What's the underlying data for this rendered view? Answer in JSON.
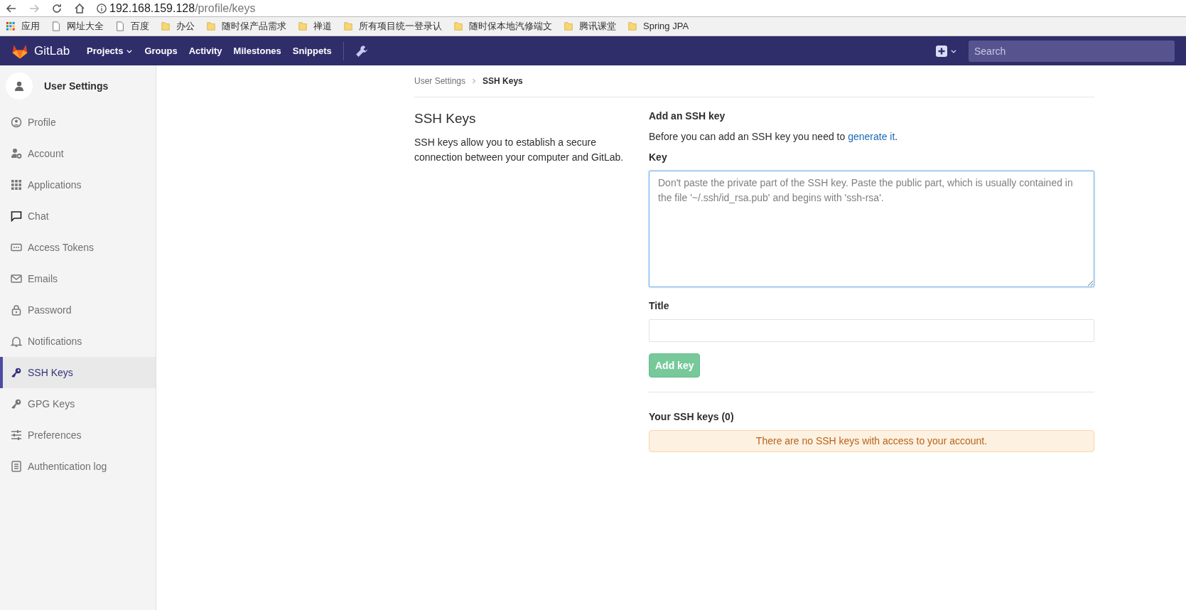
{
  "browser": {
    "url_host": "192.168.159.128",
    "url_path": "/profile/keys",
    "bookmarks": [
      {
        "kind": "apps",
        "label": "应用"
      },
      {
        "kind": "page",
        "label": "网址大全"
      },
      {
        "kind": "page",
        "label": "百度"
      },
      {
        "kind": "folder",
        "label": "办公"
      },
      {
        "kind": "folder",
        "label": "随时保产品需求"
      },
      {
        "kind": "folder",
        "label": "禅道"
      },
      {
        "kind": "folder",
        "label": "所有项目统一登录认"
      },
      {
        "kind": "folder",
        "label": "随时保本地汽修端文"
      },
      {
        "kind": "folder",
        "label": "腾讯课堂"
      },
      {
        "kind": "folder",
        "label": "Spring JPA"
      }
    ]
  },
  "navbar": {
    "brand": "GitLab",
    "links": [
      {
        "label": "Projects",
        "dropdown": true
      },
      {
        "label": "Groups",
        "dropdown": false
      },
      {
        "label": "Activity",
        "dropdown": false
      },
      {
        "label": "Milestones",
        "dropdown": false
      },
      {
        "label": "Snippets",
        "dropdown": false
      }
    ],
    "search": {
      "placeholder": "Search"
    }
  },
  "sidebar": {
    "title": "User Settings",
    "items": [
      {
        "label": "Profile",
        "selected": false
      },
      {
        "label": "Account",
        "selected": false
      },
      {
        "label": "Applications",
        "selected": false
      },
      {
        "label": "Chat",
        "selected": false
      },
      {
        "label": "Access Tokens",
        "selected": false
      },
      {
        "label": "Emails",
        "selected": false
      },
      {
        "label": "Password",
        "selected": false
      },
      {
        "label": "Notifications",
        "selected": false
      },
      {
        "label": "SSH Keys",
        "selected": true
      },
      {
        "label": "GPG Keys",
        "selected": false
      },
      {
        "label": "Preferences",
        "selected": false
      },
      {
        "label": "Authentication log",
        "selected": false
      }
    ]
  },
  "breadcrumb": [
    {
      "label": "User Settings",
      "current": false
    },
    {
      "label": "SSH Keys",
      "current": true
    }
  ],
  "intro": {
    "title": "SSH Keys",
    "text": "SSH keys allow you to establish a secure connection between your computer and GitLab."
  },
  "form": {
    "heading": "Add an SSH key",
    "hint": "Before you can add an SSH key you need to ",
    "hint_link": "generate it",
    "hint_end": ".",
    "key_label": "Key",
    "key_placeholder": "Don't paste the private part of the SSH key. Paste the public part, which is usually contained in the file '~/.ssh/id_rsa.pub' and begins with 'ssh-rsa'.",
    "title_label": "Title",
    "submit": "Add key",
    "submit_disabled": true
  },
  "keys": {
    "heading": "Your SSH keys (0)",
    "empty": "There are no SSH keys with access to your account."
  }
}
